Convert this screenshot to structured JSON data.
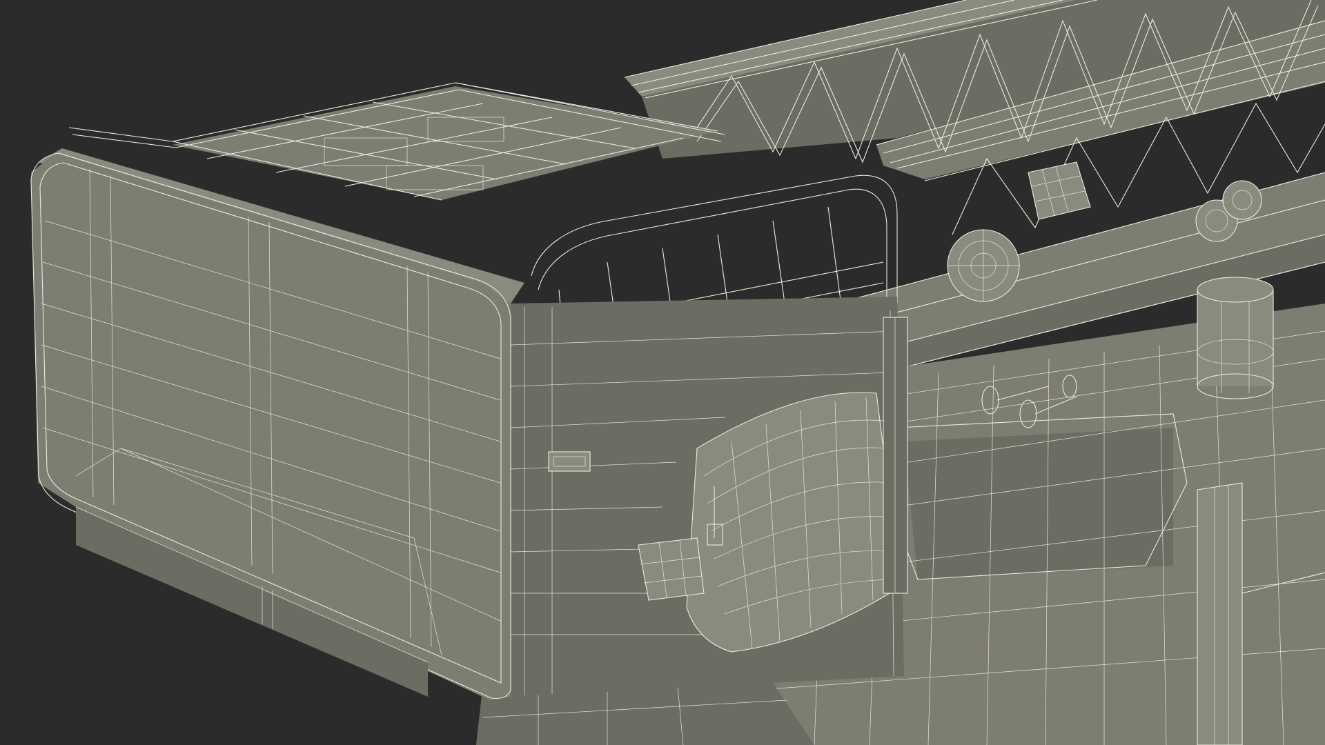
{
  "scene": {
    "subject": "wireframe-render",
    "colors": {
      "background": "#2b2b2b",
      "surface": "#7d7d72",
      "surface_dark": "#6c6c62",
      "wire": "#ecebdf"
    }
  }
}
